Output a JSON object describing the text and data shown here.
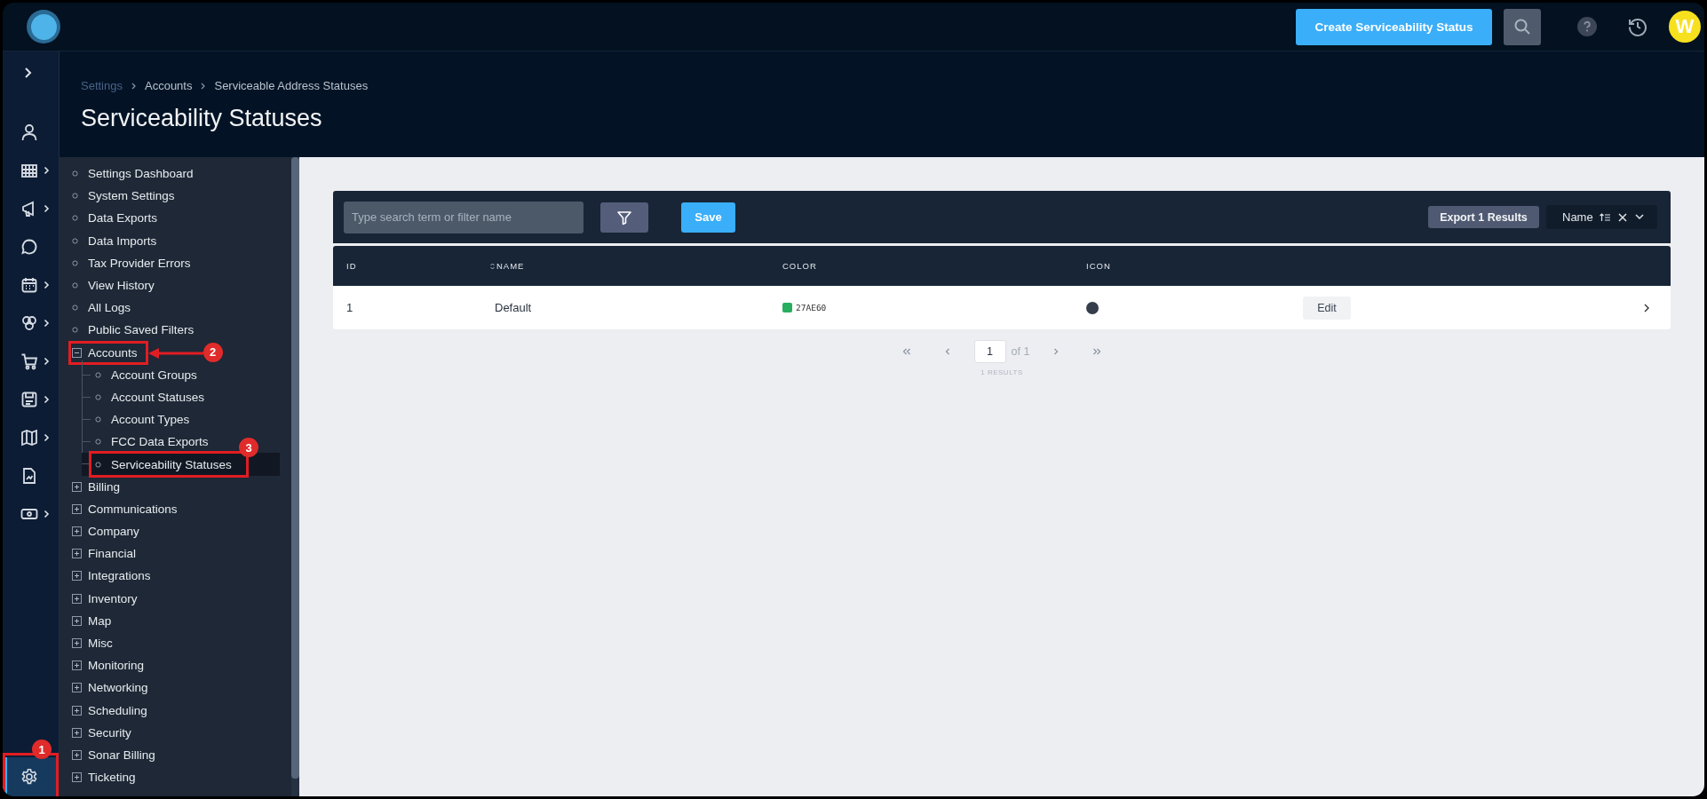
{
  "top_bar": {
    "create_button": "Create Serviceability Status",
    "avatar": "W"
  },
  "rail": {
    "items": [
      {
        "submenu": false
      },
      {
        "submenu": true
      },
      {
        "submenu": true
      },
      {
        "submenu": false
      },
      {
        "submenu": true
      },
      {
        "submenu": true
      },
      {
        "submenu": true
      },
      {
        "submenu": true
      },
      {
        "submenu": true
      },
      {
        "submenu": false
      },
      {
        "submenu": true
      }
    ],
    "settings": {
      "selected": true,
      "annotation": {
        "number": "1"
      }
    }
  },
  "breadcrumb": [
    {
      "label": "Settings",
      "link": true
    },
    {
      "label": "Accounts",
      "link": false
    },
    {
      "label": "Serviceable Address Statuses",
      "link": false
    }
  ],
  "page_title": "Serviceability Statuses",
  "tree": [
    {
      "kind": "leaf",
      "label": "Settings Dashboard",
      "selected": false
    },
    {
      "kind": "leaf",
      "label": "System Settings",
      "selected": false
    },
    {
      "kind": "leaf",
      "label": "Data Exports",
      "selected": false
    },
    {
      "kind": "leaf",
      "label": "Data Imports",
      "selected": false
    },
    {
      "kind": "leaf",
      "label": "Tax Provider Errors",
      "selected": false
    },
    {
      "kind": "leaf",
      "label": "View History",
      "selected": false
    },
    {
      "kind": "leaf",
      "label": "All Logs",
      "selected": false
    },
    {
      "kind": "leaf",
      "label": "Public Saved Filters",
      "selected": false
    },
    {
      "kind": "group",
      "label": "Accounts",
      "expanded": true,
      "annotation": {
        "number": "2",
        "arrow": true
      },
      "children": [
        {
          "kind": "leaf",
          "label": "Account Groups",
          "selected": false
        },
        {
          "kind": "leaf",
          "label": "Account Statuses",
          "selected": false
        },
        {
          "kind": "leaf",
          "label": "Account Types",
          "selected": false
        },
        {
          "kind": "leaf",
          "label": "FCC Data Exports",
          "selected": false
        },
        {
          "kind": "leaf",
          "label": "Serviceability Statuses",
          "selected": true,
          "annotation": {
            "number": "3"
          }
        }
      ]
    },
    {
      "kind": "group",
      "label": "Billing",
      "expanded": false
    },
    {
      "kind": "group",
      "label": "Communications",
      "expanded": false
    },
    {
      "kind": "group",
      "label": "Company",
      "expanded": false
    },
    {
      "kind": "group",
      "label": "Financial",
      "expanded": false
    },
    {
      "kind": "group",
      "label": "Integrations",
      "expanded": false
    },
    {
      "kind": "group",
      "label": "Inventory",
      "expanded": false
    },
    {
      "kind": "group",
      "label": "Map",
      "expanded": false
    },
    {
      "kind": "group",
      "label": "Misc",
      "expanded": false
    },
    {
      "kind": "group",
      "label": "Monitoring",
      "expanded": false
    },
    {
      "kind": "group",
      "label": "Networking",
      "expanded": false
    },
    {
      "kind": "group",
      "label": "Scheduling",
      "expanded": false
    },
    {
      "kind": "group",
      "label": "Security",
      "expanded": false
    },
    {
      "kind": "group",
      "label": "Sonar Billing",
      "expanded": false
    },
    {
      "kind": "group",
      "label": "Ticketing",
      "expanded": false
    }
  ],
  "toolbar": {
    "search_placeholder": "Type search term or filter name",
    "save_button": "Save",
    "export_button": "Export 1 Results",
    "sort_field": "Name"
  },
  "table": {
    "columns": [
      {
        "label": "ID",
        "sortable": false
      },
      {
        "label": "NAME",
        "sortable": true
      },
      {
        "label": "COLOR",
        "sortable": false
      },
      {
        "label": "ICON",
        "sortable": false
      }
    ],
    "rows": [
      {
        "id": "1",
        "name": "Default",
        "color": "#27ae60",
        "color_code": "27AE60",
        "action": "Edit"
      }
    ]
  },
  "pagination": {
    "page": "1",
    "of": "of 1",
    "results": "1 RESULTS"
  }
}
